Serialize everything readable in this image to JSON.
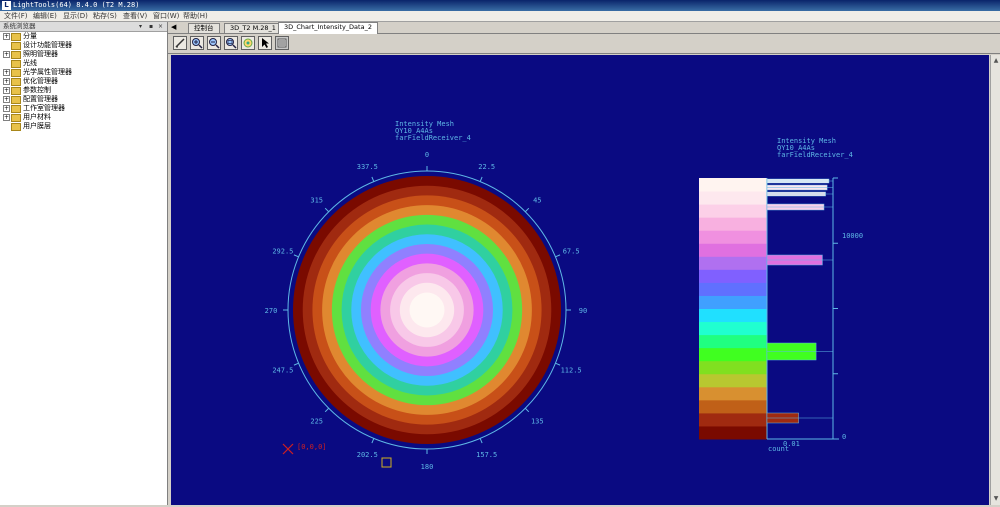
{
  "window": {
    "title": "LightTools(64) 8.4.0  (T2 M.28)",
    "app_icon": "L"
  },
  "menu": [
    "文件(F)",
    "编辑(E)",
    "显示(D)",
    "粘存(S)",
    "查看(V)",
    "窗口(W)",
    "帮助(H)"
  ],
  "left_panel": {
    "title": "系统浏览器",
    "controls": [
      "▾",
      "▪",
      "×"
    ],
    "items": [
      {
        "label": "分量",
        "expandable": true
      },
      {
        "label": "设计功能管理器",
        "expandable": false
      },
      {
        "label": "照明管理器",
        "expandable": true
      },
      {
        "label": "光线",
        "expandable": false
      },
      {
        "label": "光学属性管理器",
        "expandable": true
      },
      {
        "label": "优化管理器",
        "expandable": true
      },
      {
        "label": "参数控制",
        "expandable": true
      },
      {
        "label": "配置管理器",
        "expandable": true
      },
      {
        "label": "工作室管理器",
        "expandable": true
      },
      {
        "label": "用户材料",
        "expandable": true
      },
      {
        "label": "用户膜层",
        "expandable": false
      }
    ]
  },
  "tabs": {
    "arrow": "◀",
    "items": [
      {
        "label": "控制台",
        "active": false
      },
      {
        "label": "3D_T2 M.28_1",
        "active": false
      },
      {
        "label": "3D_Chart_Intensity_Data_2",
        "active": true
      }
    ]
  },
  "toolbar": [
    "edit-icon",
    "zoom-in-icon",
    "zoom-out-icon",
    "zoom-window-icon",
    "rotate-icon",
    "pointer-icon",
    "properties-icon"
  ],
  "chart": {
    "polar_title": [
      "Intensity Mesh",
      "QY10_A4As",
      "farFieldReceiver_4"
    ],
    "hist_title": [
      "Intensity Mesh",
      "QY10_A4As",
      "farFieldReceiver_4"
    ],
    "angle_labels": [
      "0",
      "22.5",
      "45",
      "67.5",
      "90",
      "112.5",
      "135",
      "157.5",
      "180",
      "202.5",
      "225",
      "247.5",
      "270",
      "292.5",
      "315",
      "337.5"
    ],
    "marker_label": "[0,0,0]",
    "hist_y_labels": [
      "10000",
      "0"
    ],
    "hist_x_labels": [
      "0.01",
      "count"
    ],
    "colors": {
      "background": "#0a0a82",
      "axis": "#5fb8e6",
      "text": "#5fb8e6"
    }
  },
  "chart_data": {
    "type": "heatmap",
    "title": "Intensity Mesh",
    "subtitle": "QY10_A4As farFieldReceiver_4",
    "angular_ticks_deg": [
      0,
      22.5,
      45,
      67.5,
      90,
      112.5,
      135,
      157.5,
      180,
      202.5,
      225,
      247.5,
      270,
      292.5,
      315,
      337.5
    ],
    "radial_bands_outer_to_inner": [
      "#7a0a00",
      "#a02a10",
      "#c85018",
      "#e08830",
      "#60e040",
      "#30d0a0",
      "#40c0ff",
      "#9080ff",
      "#e060ff",
      "#f0a0e0",
      "#f8c8e8",
      "#fde8ee",
      "#fff8f4"
    ],
    "legend_scale_colors_bottom_to_top": [
      "#7a0a00",
      "#a02a10",
      "#c06018",
      "#d89030",
      "#b8c830",
      "#80e020",
      "#40ff20",
      "#20ff80",
      "#20ffd0",
      "#20e0ff",
      "#40a0ff",
      "#6070ff",
      "#8060ff",
      "#b070f0",
      "#e070e0",
      "#f090e0",
      "#f8b0e0",
      "#fcd0e8",
      "#fde8ee",
      "#fff4f0"
    ],
    "histogram": {
      "y_axis": {
        "labels": [
          "10000",
          "0"
        ]
      },
      "x_axis": {
        "labels": [
          "0.01"
        ],
        "title": "count"
      },
      "bars_fraction_of_axis_top_to_bottom": [
        0.45,
        0.38,
        0.37,
        0.36,
        0.35,
        0.31,
        0.2,
        0.12
      ]
    }
  }
}
